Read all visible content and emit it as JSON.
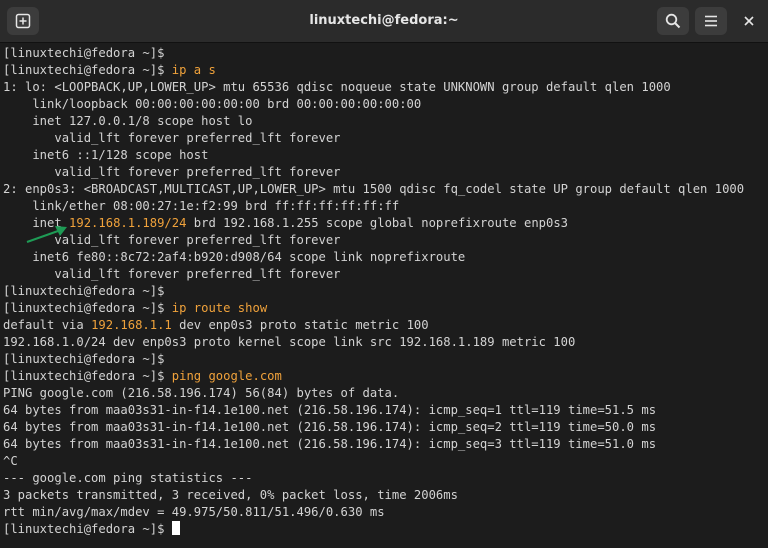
{
  "window": {
    "title": "linuxtechi@fedora:~"
  },
  "icons": {
    "new_tab": "new-tab-icon",
    "search": "search-icon",
    "menu": "hamburger-menu-icon",
    "close": "close-icon"
  },
  "colors": {
    "background": "#1c1c1c",
    "text": "#d3d3d3",
    "highlight": "#f0a23b",
    "arrow": "#1e9b55"
  },
  "terminal": {
    "lines": [
      [
        {
          "t": "[linuxtechi@fedora ~]$"
        }
      ],
      [
        {
          "t": "[linuxtechi@fedora ~]$ "
        },
        {
          "t": "ip a s",
          "hl": true
        }
      ],
      [
        {
          "t": "1: lo: <LOOPBACK,UP,LOWER_UP> mtu 65536 qdisc noqueue state UNKNOWN group default qlen 1000"
        }
      ],
      [
        {
          "t": "    link/loopback 00:00:00:00:00:00 brd 00:00:00:00:00:00"
        }
      ],
      [
        {
          "t": "    inet 127.0.0.1/8 scope host lo"
        }
      ],
      [
        {
          "t": "       valid_lft forever preferred_lft forever"
        }
      ],
      [
        {
          "t": "    inet6 ::1/128 scope host"
        }
      ],
      [
        {
          "t": "       valid_lft forever preferred_lft forever"
        }
      ],
      [
        {
          "t": "2: enp0s3: <BROADCAST,MULTICAST,UP,LOWER_UP> mtu 1500 qdisc fq_codel state UP group default qlen 1000"
        }
      ],
      [
        {
          "t": "    link/ether 08:00:27:1e:f2:99 brd ff:ff:ff:ff:ff:ff"
        }
      ],
      [
        {
          "t": "    inet "
        },
        {
          "t": "192.168.1.189/24",
          "hl": true
        },
        {
          "t": " brd 192.168.1.255 scope global noprefixroute enp0s3"
        }
      ],
      [
        {
          "t": "       valid_lft forever preferred_lft forever"
        }
      ],
      [
        {
          "t": "    inet6 fe80::8c72:2af4:b920:d908/64 scope link noprefixroute"
        }
      ],
      [
        {
          "t": "       valid_lft forever preferred_lft forever"
        }
      ],
      [
        {
          "t": "[linuxtechi@fedora ~]$"
        }
      ],
      [
        {
          "t": "[linuxtechi@fedora ~]$ "
        },
        {
          "t": "ip route show",
          "hl": true
        }
      ],
      [
        {
          "t": "default via "
        },
        {
          "t": "192.168.1.1",
          "hl": true
        },
        {
          "t": " dev enp0s3 proto static metric 100"
        }
      ],
      [
        {
          "t": "192.168.1.0/24 dev enp0s3 proto kernel scope link src 192.168.1.189 metric 100"
        }
      ],
      [
        {
          "t": "[linuxtechi@fedora ~]$"
        }
      ],
      [
        {
          "t": "[linuxtechi@fedora ~]$ "
        },
        {
          "t": "ping google.com",
          "hl": true
        }
      ],
      [
        {
          "t": "PING google.com (216.58.196.174) 56(84) bytes of data."
        }
      ],
      [
        {
          "t": "64 bytes from maa03s31-in-f14.1e100.net (216.58.196.174): icmp_seq=1 ttl=119 time=51.5 ms"
        }
      ],
      [
        {
          "t": "64 bytes from maa03s31-in-f14.1e100.net (216.58.196.174): icmp_seq=2 ttl=119 time=50.0 ms"
        }
      ],
      [
        {
          "t": "64 bytes from maa03s31-in-f14.1e100.net (216.58.196.174): icmp_seq=3 ttl=119 time=51.0 ms"
        }
      ],
      [
        {
          "t": "^C"
        }
      ],
      [
        {
          "t": "--- google.com ping statistics ---"
        }
      ],
      [
        {
          "t": "3 packets transmitted, 3 received, 0% packet loss, time 2006ms"
        }
      ],
      [
        {
          "t": "rtt min/avg/max/mdev = 49.975/50.811/51.496/0.630 ms"
        }
      ],
      [
        {
          "t": "[linuxtechi@fedora ~]$ "
        }
      ]
    ]
  }
}
